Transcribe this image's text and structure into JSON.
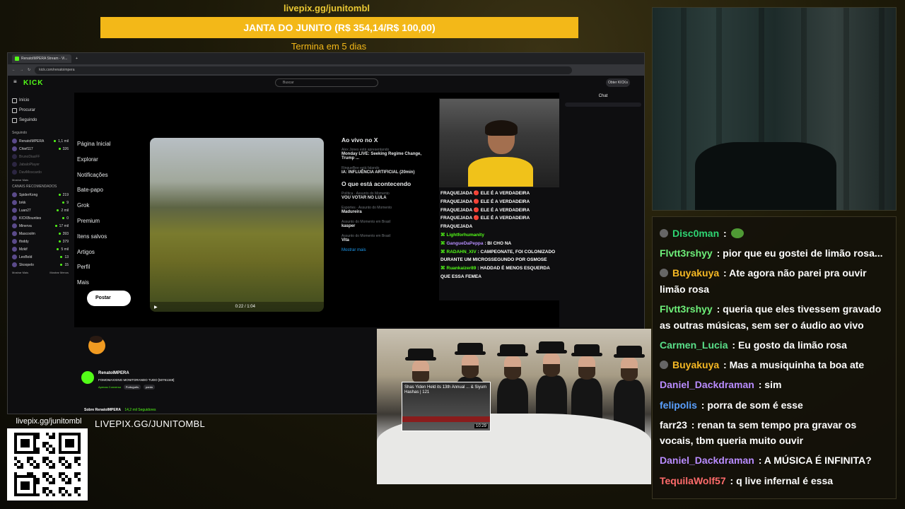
{
  "goal": {
    "url": "livepix.gg/junitombl",
    "title": "JANTA DO JUNITO (R$ 354,14/R$ 100,00)",
    "subtitle": "Termina em 5 dias"
  },
  "browser": {
    "tab_title": "RenatoIMPERA Stream - Vi...",
    "url": "kick.com/renatoimpera"
  },
  "kick": {
    "logo": "KICK",
    "search_placeholder": "Buscar",
    "get_kicks": "Obter KICKs",
    "nav": [
      "Início",
      "Procurar",
      "Seguindo"
    ],
    "following_header": "Seguindo",
    "following": [
      {
        "name": "RenatoIMPERA",
        "viewers": "1,1 mil"
      },
      {
        "name": "Chief117",
        "viewers": "326"
      },
      {
        "name": "BrunoDiasFF",
        "viewers": ""
      },
      {
        "name": "JabaloPlayer",
        "viewers": ""
      },
      {
        "name": "DaviMoscardo",
        "viewers": ""
      }
    ],
    "show_more": "Mostrar Mais",
    "recommended_header": "CANAIS RECOMENDADOS",
    "recommended": [
      {
        "name": "SpiderKong",
        "viewers": "219"
      },
      {
        "name": "brkk",
        "viewers": "9"
      },
      {
        "name": "Luan27",
        "viewers": "2 mil"
      },
      {
        "name": "KICKBounties",
        "viewers": "0"
      },
      {
        "name": "Minerva",
        "viewers": "17 mil"
      },
      {
        "name": "Mascoolm",
        "viewers": "393"
      },
      {
        "name": "tfoddy",
        "viewers": "379"
      },
      {
        "name": "Mzkif",
        "viewers": "5 mil"
      },
      {
        "name": "LeoBold",
        "viewers": "13"
      },
      {
        "name": "Skoopelo",
        "viewers": "15"
      }
    ],
    "show_more_bottom": "Mostrar Mais",
    "show_less_bottom": "Mostrar Menos",
    "chat_title": "Chat"
  },
  "x": {
    "nav": [
      "Página Inicial",
      "Explorar",
      "Notificações",
      "Bate-papo",
      "Grok",
      "Premium",
      "Itens salvos",
      "Artigos",
      "Perfil",
      "Mais"
    ],
    "post_button": "Postar",
    "video_time": "0:22 / 1:04",
    "live_header": "Ao vivo no X",
    "live_items": [
      {
        "user": "Alex Jones",
        "status": "está apresentando",
        "text": "Monday LIVE: Seeking Regime Change, Trump ..."
      },
      {
        "user": "RingueBee",
        "status": "está falando",
        "text": "IA: INFLUÊNCIA ARTIFICIAL (20min)"
      }
    ],
    "happening_header": "O que está acontecendo",
    "trends": [
      {
        "context": "Política · Assunto do Momento",
        "title": "VOU VOTAR NO LULA"
      },
      {
        "context": "Esportes · Assunto do Momento",
        "title": "Madureira"
      },
      {
        "context": "Assunto do Momento em Brasil",
        "title": "kasper"
      },
      {
        "context": "Assunto do Momento em Brasil",
        "title": "Vita"
      }
    ],
    "show_more": "Mostrar mais"
  },
  "stream_chat": [
    {
      "user": "",
      "text": "FRAQUEJADA 🔴 ELE É A VERDADEIRA",
      "color": "#ffffff"
    },
    {
      "user": "",
      "text": "FRAQUEJADA 🔴 ELE É A VERDADEIRA",
      "color": "#ffffff"
    },
    {
      "user": "",
      "text": "FRAQUEJADA 🔴 ELE É A VERDADEIRA",
      "color": "#ffffff"
    },
    {
      "user": "",
      "text": "FRAQUEJADA 🔴 ELE É A VERDADEIRA",
      "color": "#ffffff"
    },
    {
      "user": "",
      "text": "FRAQUEJADA",
      "color": "#ffffff"
    },
    {
      "user": "Lightforhumanity",
      "text": "",
      "color": "#53fc18"
    },
    {
      "user": "GangueDaPeppa",
      "text": "BI CHO NA",
      "color": "#b58dfc"
    },
    {
      "user": "RADAHN_XIV",
      "text": "CAMPEONATE, FOI COLONIZADO DURANTE UM MICROSSEGUNDO POR OSMOSE",
      "color": "#53fc18"
    },
    {
      "user": "Ruankaizer89",
      "text": "HADDAD É MENOS ESQUERDA QUE ESSA FEMEA",
      "color": "#53fc18"
    }
  ],
  "channel": {
    "name": "RenatoIMPERA",
    "title": "FOMOMAXXING MONITORANDO TUDO [50761348]",
    "category": "Apenas Conversa",
    "tags": [
      "Português",
      "pardo"
    ],
    "about": "Sobre RenatoIMPERA",
    "followers": "14,2 mil Seguidores"
  },
  "overlay_video": {
    "thumb_title": "Shas Yiden Held its 13th Annual ... & Siyum Hashas | 121",
    "thumb_duration": "10:29"
  },
  "qr": {
    "label": "livepix.gg/junitombl"
  },
  "livepix_text": "LIVEPIX.GG/JUNITOMBL",
  "overlay_chat": [
    {
      "user": "Disc0man",
      "text": "",
      "color": "#2ed573",
      "badge": true,
      "emote": true
    },
    {
      "user": "Flvtt3rshyy",
      "text": "pior que eu gostei de limão rosa...",
      "color": "#6ef07a",
      "badge": false,
      "emote": false
    },
    {
      "user": "Buyakuya",
      "text": "Ate agora não parei pra ouvir limão rosa",
      "color": "#f5b824",
      "badge": true,
      "emote": false
    },
    {
      "user": "Flvtt3rshyy",
      "text": "queria que eles tivessem gravado as outras músicas, sem ser o áudio ao vivo",
      "color": "#6ef07a",
      "badge": false,
      "emote": false
    },
    {
      "user": "Carmen_Lucia",
      "text": "Eu gosto da limão rosa",
      "color": "#5ae08a",
      "badge": false,
      "emote": false
    },
    {
      "user": "Buyakuya",
      "text": "Mas a musiquinha ta boa ate",
      "color": "#f5b824",
      "badge": true,
      "emote": false
    },
    {
      "user": "Daniel_Dackdraman",
      "text": "sim",
      "color": "#b98cff",
      "badge": false,
      "emote": false
    },
    {
      "user": "felipolis",
      "text": "porra de som é esse",
      "color": "#5aa0ff",
      "badge": false,
      "emote": false
    },
    {
      "user": "farr23",
      "text": "renan ta sem tempo pra gravar os vocais, tbm queria muito ouvir",
      "color": "#ffffff",
      "badge": false,
      "emote": false
    },
    {
      "user": "Daniel_Dackdraman",
      "text": "A MÚSICA É INFINITA?",
      "color": "#b98cff",
      "badge": false,
      "emote": false
    },
    {
      "user": "TequilaWolf57",
      "text": "q live infernal é essa",
      "color": "#ff6b6b",
      "badge": false,
      "emote": false
    }
  ],
  "colors": {
    "accent": "#f3b818",
    "kick_green": "#53fc18"
  }
}
